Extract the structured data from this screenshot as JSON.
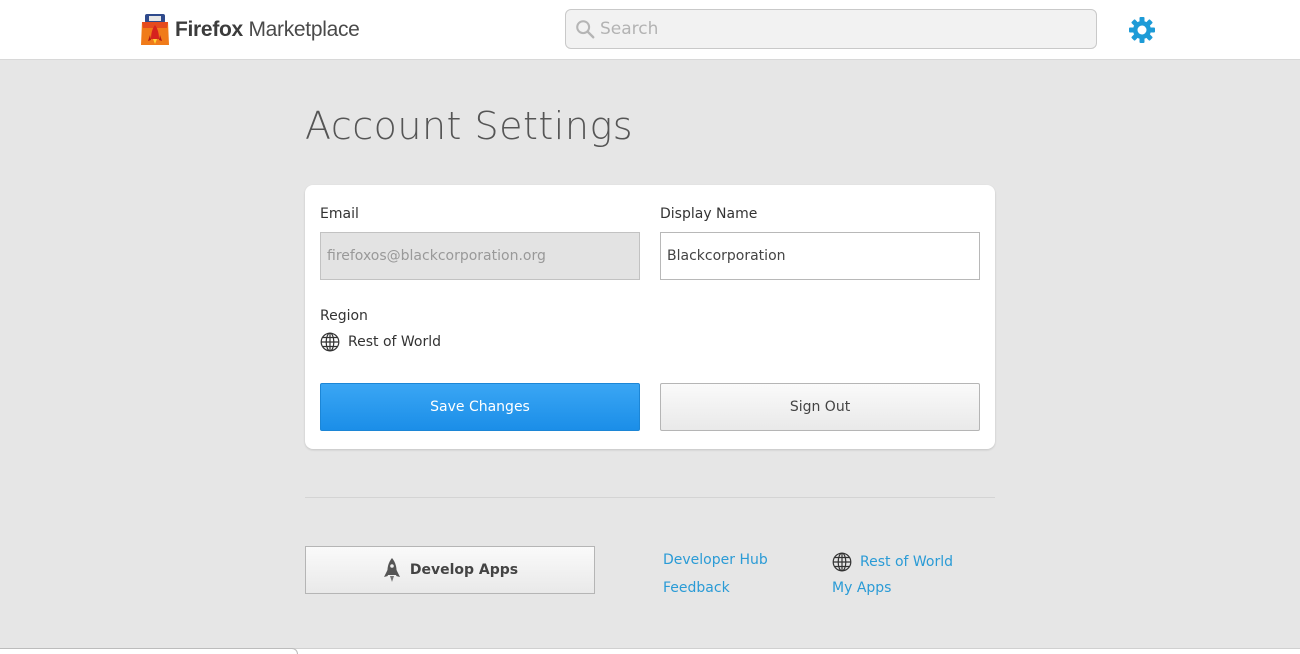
{
  "header": {
    "logo_text_bold": "Firefox",
    "logo_text_rest": " Marketplace",
    "search_placeholder": "Search",
    "accent_color": "#1d9bd7"
  },
  "page": {
    "title": "Account Settings"
  },
  "form": {
    "email_label": "Email",
    "email_value": "firefoxos@blackcorporation.org",
    "display_name_label": "Display Name",
    "display_name_value": "Blackcorporation",
    "region_label": "Region",
    "region_value": "Rest of World",
    "save_label": "Save Changes",
    "signout_label": "Sign Out",
    "primary_color": "#2196f3"
  },
  "footer": {
    "develop_label": "Develop Apps",
    "developer_hub": "Developer Hub",
    "feedback": "Feedback",
    "region": "Rest of World",
    "my_apps": "My Apps",
    "link_color": "#2a9bd6"
  }
}
